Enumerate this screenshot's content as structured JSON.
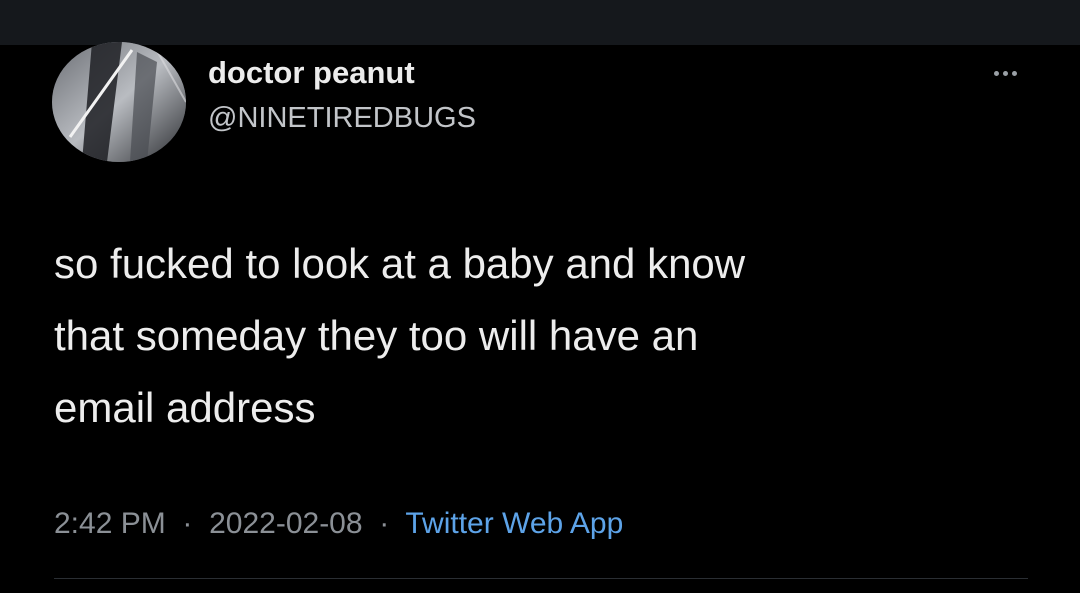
{
  "tweet": {
    "display_name": "doctor peanut",
    "handle": "@NINETIREDBUGS",
    "text": "so fucked to look at a baby and know\nthat someday they too will have an\nemail address",
    "time": "2:42 PM",
    "date": "2022-02-08",
    "source": "Twitter Web App",
    "separator": "·"
  },
  "icons": {
    "more": "more-horizontal-icon"
  },
  "colors": {
    "background": "#000000",
    "top_bar": "#15181c",
    "text": "#ededed",
    "muted": "#8b9096",
    "link": "#5da3e8"
  }
}
